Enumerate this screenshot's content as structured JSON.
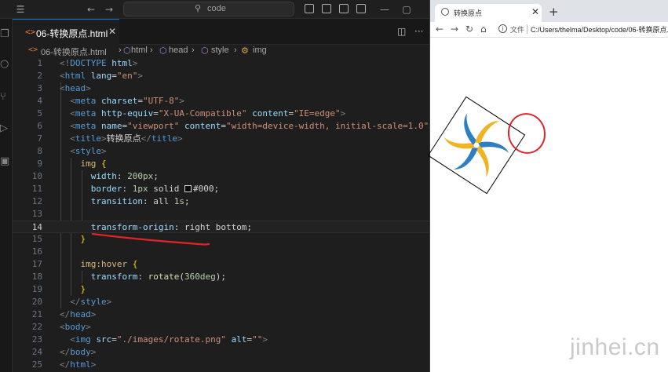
{
  "vscode": {
    "search_placeholder": "code",
    "tab_title": "06-转换原点.html",
    "breadcrumb": [
      "06-转换原点.html",
      "html",
      "head",
      "style",
      "img"
    ],
    "current_line": 14,
    "lines": [
      {
        "n": "1",
        "tokens": [
          [
            "t-br",
            "<!"
          ],
          [
            "t-dt",
            "DOCTYPE"
          ],
          [
            "t-txt",
            " "
          ],
          [
            "t-attr",
            "html"
          ],
          [
            "t-br",
            ">"
          ]
        ]
      },
      {
        "n": "2",
        "tokens": [
          [
            "t-br",
            "<"
          ],
          [
            "t-tag",
            "html"
          ],
          [
            "t-txt",
            " "
          ],
          [
            "t-attr",
            "lang"
          ],
          [
            "t-txt",
            "="
          ],
          [
            "t-str",
            "\"en\""
          ],
          [
            "t-br",
            ">"
          ]
        ]
      },
      {
        "n": "3",
        "tokens": [
          [
            "t-br",
            "<"
          ],
          [
            "t-tag",
            "head"
          ],
          [
            "t-br",
            ">"
          ]
        ]
      },
      {
        "n": "4",
        "tokens": [
          [
            "t-txt",
            "  "
          ],
          [
            "t-br",
            "<"
          ],
          [
            "t-tag",
            "meta"
          ],
          [
            "t-txt",
            " "
          ],
          [
            "t-attr",
            "charset"
          ],
          [
            "t-txt",
            "="
          ],
          [
            "t-str",
            "\"UTF-8\""
          ],
          [
            "t-br",
            ">"
          ]
        ]
      },
      {
        "n": "5",
        "tokens": [
          [
            "t-txt",
            "  "
          ],
          [
            "t-br",
            "<"
          ],
          [
            "t-tag",
            "meta"
          ],
          [
            "t-txt",
            " "
          ],
          [
            "t-attr",
            "http-equiv"
          ],
          [
            "t-txt",
            "="
          ],
          [
            "t-str",
            "\"X-UA-Compatible\""
          ],
          [
            "t-txt",
            " "
          ],
          [
            "t-attr",
            "content"
          ],
          [
            "t-txt",
            "="
          ],
          [
            "t-str",
            "\"IE=edge\""
          ],
          [
            "t-br",
            ">"
          ]
        ]
      },
      {
        "n": "6",
        "tokens": [
          [
            "t-txt",
            "  "
          ],
          [
            "t-br",
            "<"
          ],
          [
            "t-tag",
            "meta"
          ],
          [
            "t-txt",
            " "
          ],
          [
            "t-attr",
            "name"
          ],
          [
            "t-txt",
            "="
          ],
          [
            "t-str",
            "\"viewport\""
          ],
          [
            "t-txt",
            " "
          ],
          [
            "t-attr",
            "content"
          ],
          [
            "t-txt",
            "="
          ],
          [
            "t-str",
            "\"width=device-width, initial-scale=1.0\""
          ],
          [
            "t-br",
            ">"
          ]
        ]
      },
      {
        "n": "7",
        "tokens": [
          [
            "t-txt",
            "  "
          ],
          [
            "t-br",
            "<"
          ],
          [
            "t-tag",
            "title"
          ],
          [
            "t-br",
            ">"
          ],
          [
            "t-txt",
            "转换原点"
          ],
          [
            "t-br",
            "</"
          ],
          [
            "t-tag",
            "title"
          ],
          [
            "t-br",
            ">"
          ]
        ]
      },
      {
        "n": "8",
        "tokens": [
          [
            "t-txt",
            "  "
          ],
          [
            "t-br",
            "<"
          ],
          [
            "t-tag",
            "style"
          ],
          [
            "t-br",
            ">"
          ]
        ]
      },
      {
        "n": "9",
        "tokens": [
          [
            "t-txt",
            "    "
          ],
          [
            "t-sel",
            "img"
          ],
          [
            "t-txt",
            " "
          ],
          [
            "t-brace",
            "{"
          ]
        ]
      },
      {
        "n": "10",
        "tokens": [
          [
            "t-txt",
            "      "
          ],
          [
            "t-prop",
            "width"
          ],
          [
            "t-txt",
            ": "
          ],
          [
            "t-num",
            "200px"
          ],
          [
            "t-txt",
            ";"
          ]
        ]
      },
      {
        "n": "11",
        "tokens": [
          [
            "t-txt",
            "      "
          ],
          [
            "t-prop",
            "border"
          ],
          [
            "t-txt",
            ": "
          ],
          [
            "t-num",
            "1px"
          ],
          [
            "t-txt",
            " solid "
          ],
          [
            "swatch",
            ""
          ],
          [
            "t-txt",
            "#000;"
          ]
        ]
      },
      {
        "n": "12",
        "tokens": [
          [
            "t-txt",
            "      "
          ],
          [
            "t-prop",
            "transition"
          ],
          [
            "t-txt",
            ": all "
          ],
          [
            "t-num",
            "1s"
          ],
          [
            "t-txt",
            ";"
          ]
        ]
      },
      {
        "n": "13",
        "tokens": []
      },
      {
        "n": "14",
        "tokens": [
          [
            "t-txt",
            "      "
          ],
          [
            "t-prop",
            "transform-origin"
          ],
          [
            "t-txt",
            ": right bottom;"
          ]
        ]
      },
      {
        "n": "15",
        "tokens": [
          [
            "t-txt",
            "    "
          ],
          [
            "t-brace",
            "}"
          ]
        ]
      },
      {
        "n": "16",
        "tokens": []
      },
      {
        "n": "17",
        "tokens": [
          [
            "t-txt",
            "    "
          ],
          [
            "t-sel",
            "img:hover"
          ],
          [
            "t-txt",
            " "
          ],
          [
            "t-brace",
            "{"
          ]
        ]
      },
      {
        "n": "18",
        "tokens": [
          [
            "t-txt",
            "      "
          ],
          [
            "t-prop",
            "transform"
          ],
          [
            "t-txt",
            ": "
          ],
          [
            "t-fn",
            "rotate"
          ],
          [
            "t-txt",
            "("
          ],
          [
            "t-num",
            "360deg"
          ],
          [
            "t-txt",
            ");"
          ]
        ]
      },
      {
        "n": "19",
        "tokens": [
          [
            "t-txt",
            "    "
          ],
          [
            "t-brace",
            "}"
          ]
        ]
      },
      {
        "n": "20",
        "tokens": [
          [
            "t-txt",
            "  "
          ],
          [
            "t-br",
            "</"
          ],
          [
            "t-tag",
            "style"
          ],
          [
            "t-br",
            ">"
          ]
        ]
      },
      {
        "n": "21",
        "tokens": [
          [
            "t-br",
            "</"
          ],
          [
            "t-tag",
            "head"
          ],
          [
            "t-br",
            ">"
          ]
        ]
      },
      {
        "n": "22",
        "tokens": [
          [
            "t-br",
            "<"
          ],
          [
            "t-tag",
            "body"
          ],
          [
            "t-br",
            ">"
          ]
        ]
      },
      {
        "n": "23",
        "tokens": [
          [
            "t-txt",
            "  "
          ],
          [
            "t-br",
            "<"
          ],
          [
            "t-tag",
            "img"
          ],
          [
            "t-txt",
            " "
          ],
          [
            "t-attr",
            "src"
          ],
          [
            "t-txt",
            "="
          ],
          [
            "t-str",
            "\"./images/rotate.png\""
          ],
          [
            "t-txt",
            " "
          ],
          [
            "t-attr",
            "alt"
          ],
          [
            "t-txt",
            "="
          ],
          [
            "t-str",
            "\"\""
          ],
          [
            "t-br",
            ">"
          ]
        ]
      },
      {
        "n": "24",
        "tokens": [
          [
            "t-br",
            "</"
          ],
          [
            "t-tag",
            "body"
          ],
          [
            "t-br",
            ">"
          ]
        ]
      },
      {
        "n": "25",
        "tokens": [
          [
            "t-br",
            "</"
          ],
          [
            "t-tag",
            "html"
          ],
          [
            "t-br",
            ">"
          ]
        ]
      }
    ]
  },
  "browser": {
    "tab_title": "转换原点",
    "file_label": "文件",
    "url": "C:/Users/thelma/Desktop/code/06-转换原点."
  },
  "watermark": "jinhei.cn",
  "colors": {
    "accent": "#0078d4",
    "annotation_red": "#e0242a",
    "logo_blue": "#2c7fc4",
    "logo_yellow": "#f2b322"
  }
}
